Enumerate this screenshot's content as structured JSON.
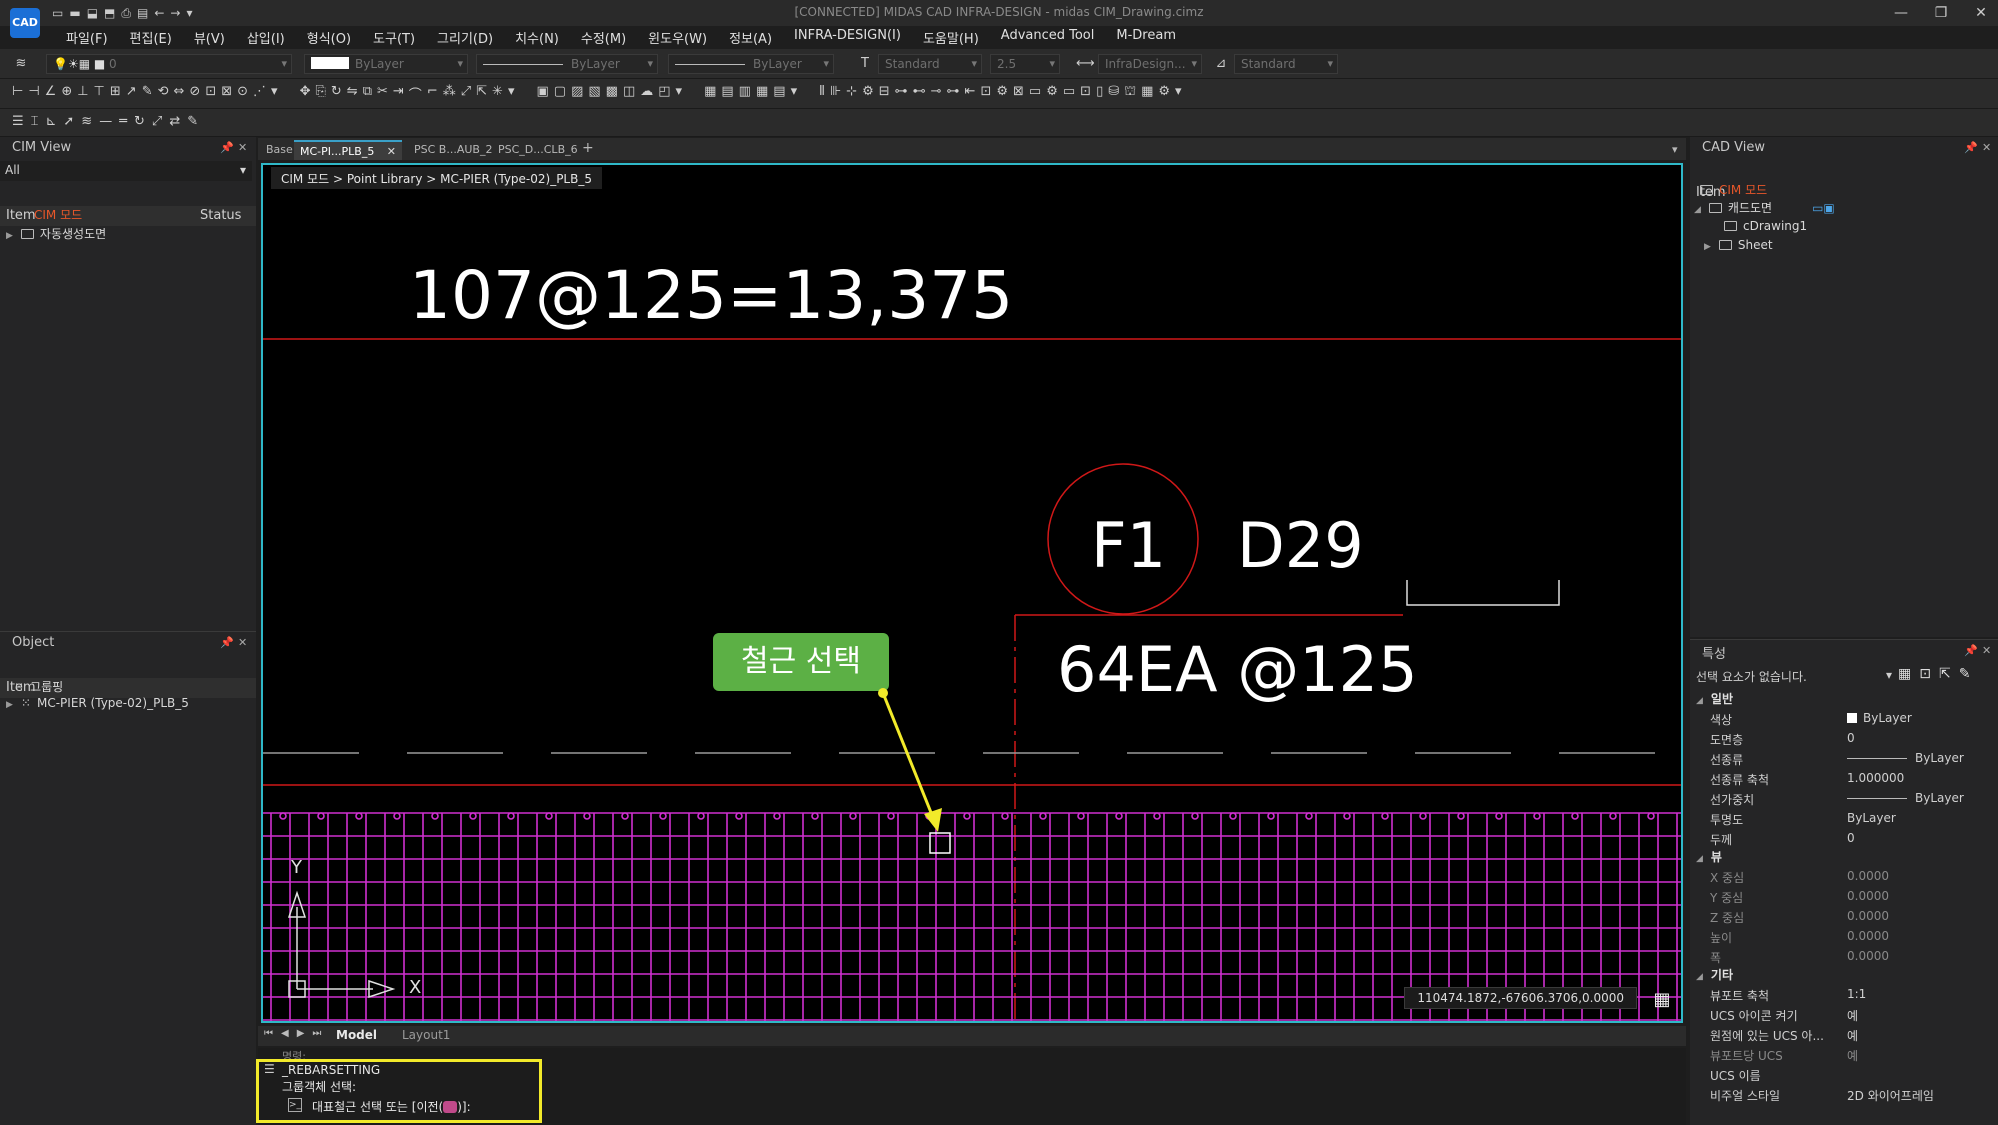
{
  "window": {
    "title": "[CONNECTED] MIDAS CAD INFRA-DESIGN - midas CIM_Drawing.cimz",
    "logo": "CAD",
    "min": "—",
    "max": "❐",
    "close": "✕"
  },
  "menu": [
    "파일(F)",
    "편집(E)",
    "뷰(V)",
    "삽입(I)",
    "형식(O)",
    "도구(T)",
    "그리기(D)",
    "치수(N)",
    "수정(M)",
    "윈도우(W)",
    "정보(A)",
    "INFRA-DESIGN(I)",
    "도움말(H)",
    "Advanced Tool",
    "M-Dream"
  ],
  "toolbar1": {
    "layer": "0",
    "color": "ByLayer",
    "linetype": "ByLayer",
    "lineweight": "ByLayer",
    "textstyle": "Standard",
    "textsize": "2.5",
    "dimstyle": "InfraDesign...",
    "tablestyle": "Standard"
  },
  "cim_view": {
    "title": "CIM View",
    "filter": "All",
    "col_item": "Item",
    "col_status": "Status",
    "items": [
      "CIM 모드",
      "자동생성도면"
    ]
  },
  "object_panel": {
    "title": "Object",
    "col_item": "Item",
    "items": [
      "그룹핑",
      "MC-PIER (Type-02)_PLB_5"
    ]
  },
  "tabs": [
    "Base",
    "MC-PI...PLB_5",
    "PSC B...AUB_2",
    "PSC_D...CLB_6"
  ],
  "breadcrumb": "CIM 모드 > Point Library > MC-PIER (Type-02)_PLB_5",
  "drawing": {
    "spacing_text": "107@125=13,375",
    "circle_label": "F1",
    "bar_size": "D29",
    "count_text": "64EA  @125",
    "axis_y": "Y",
    "axis_x": "X"
  },
  "callout": "철근 선택",
  "coords": "110474.1872,-67606.3706,0.0000",
  "layout_tabs": [
    "Model",
    "Layout1"
  ],
  "command": {
    "prev": "명령:",
    "line1": "_REBARSETTING",
    "line2": "그룹객체 선택:",
    "prompt": "대표철근 선택 또는 [이전(",
    "prompt_end": ")]:"
  },
  "cad_view": {
    "title": "CAD View",
    "col_item": "Item",
    "items": [
      "CIM 모드",
      "캐드도면",
      "cDrawing1",
      "Sheet"
    ]
  },
  "properties": {
    "title": "특성",
    "selection": "선택 요소가 없습니다.",
    "sections": {
      "general": "일반",
      "view": "뷰",
      "other": "기타"
    },
    "general": [
      [
        "색상",
        "ByLayer"
      ],
      [
        "도면층",
        "0"
      ],
      [
        "선종류",
        "ByLayer"
      ],
      [
        "선종류 축척",
        "1.000000"
      ],
      [
        "선가중치",
        "ByLayer"
      ],
      [
        "투명도",
        "ByLayer"
      ],
      [
        "두께",
        "0"
      ]
    ],
    "view": [
      [
        "X 중심",
        "0.0000"
      ],
      [
        "Y 중심",
        "0.0000"
      ],
      [
        "Z 중심",
        "0.0000"
      ],
      [
        "높이",
        "0.0000"
      ],
      [
        "폭",
        "0.0000"
      ]
    ],
    "other": [
      [
        "뷰포트 축척",
        "1:1"
      ],
      [
        "UCS 아이콘 켜기",
        "예"
      ],
      [
        "원점에 있는 UCS 아...",
        "예"
      ],
      [
        "뷰포트당 UCS",
        "예"
      ],
      [
        "UCS 이름",
        ""
      ],
      [
        "비주얼 스타일",
        "2D 와이어프레임"
      ]
    ]
  },
  "colors": {
    "accent": "#2fb8c8",
    "rebar": "#d030d0",
    "dim_line": "#d01818",
    "callout_bg": "#5cb045",
    "highlight": "#f2ea2a",
    "cim_orange": "#e8572a"
  }
}
